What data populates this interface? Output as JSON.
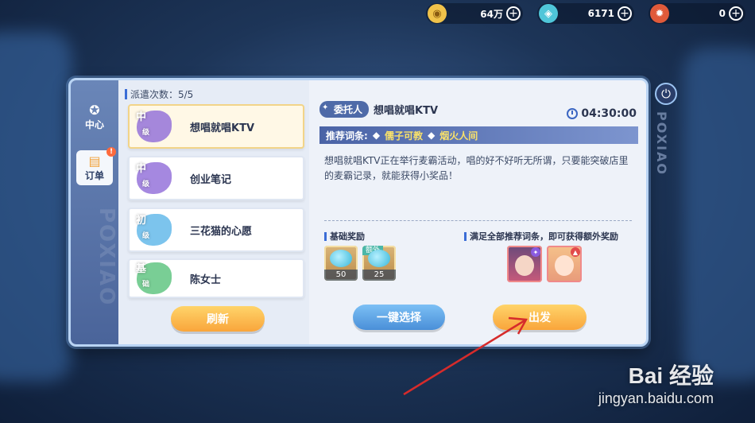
{
  "currencies": [
    {
      "icon": "gold-coin-icon",
      "value": "64万"
    },
    {
      "icon": "crystal-icon",
      "value": "6171"
    },
    {
      "icon": "gear-token-icon",
      "value": "0"
    }
  ],
  "rail": {
    "center_label": "中心",
    "orders_label": "订单",
    "badge": "!"
  },
  "dispatch": "派遣次数：5/5",
  "tasks": [
    {
      "level_top": "中",
      "level_bottom": "级",
      "title": "想唱就唱KTV",
      "color": "#8f6ad8"
    },
    {
      "level_top": "中",
      "level_bottom": "级",
      "title": "创业笔记",
      "color": "#8f6ad8"
    },
    {
      "level_top": "初",
      "level_bottom": "级",
      "title": "三花猫的心愿",
      "color": "#5bb5e8"
    },
    {
      "level_top": "基",
      "level_bottom": "础",
      "title": "陈女士",
      "color": "#57c27a"
    }
  ],
  "refresh_label": "刷新",
  "detail": {
    "client_tag": "委托人",
    "task_name": "想唱就唱KTV",
    "timer": "04:30:00",
    "rec_label": "推荐词条:",
    "keyword_1": "儒子可教",
    "keyword_2": "烟火人间",
    "description": "想唱就唱KTV正在举行麦霸活动，唱的好不好听无所谓，只要能突破店里的麦霸记录，就能获得小奖品！",
    "base_reward_title": "基础奖励",
    "bonus_title": "满足全部推荐词条，即可获得额外奖励",
    "rewards": [
      {
        "qty": "50",
        "extra": ""
      },
      {
        "qty": "25",
        "extra": "额外"
      }
    ]
  },
  "one_click_label": "一键选择",
  "depart_label": "出发",
  "watermark_line1": "Bai 经验",
  "watermark_line2": "jingyan.baidu.com",
  "side_text": "POXIAO"
}
